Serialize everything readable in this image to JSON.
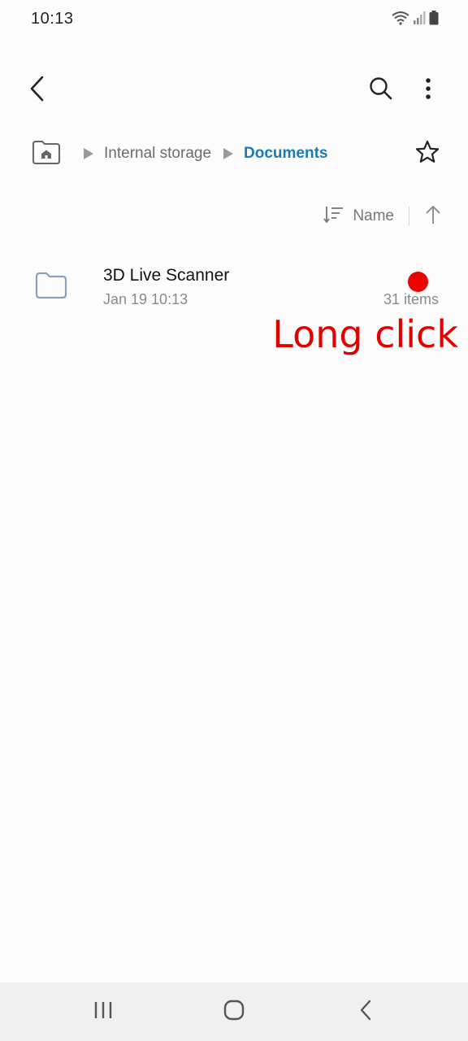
{
  "status_bar": {
    "time": "10:13",
    "icons": [
      "wifi-icon",
      "signal-icon",
      "battery-icon"
    ]
  },
  "app_bar": {
    "back_icon": "chevron-left-icon",
    "search_icon": "search-icon",
    "more_icon": "more-vertical-icon"
  },
  "breadcrumb": {
    "home_icon": "home-folder-icon",
    "items": [
      {
        "label": "Internal storage"
      },
      {
        "label": "Documents"
      }
    ],
    "favorite_icon": "star-outline-icon"
  },
  "sort": {
    "label": "Name",
    "direction_icon": "arrow-up-icon"
  },
  "files": [
    {
      "name": "3D Live Scanner",
      "date": "Jan 19 10:13",
      "count": "31 items",
      "icon": "folder-icon"
    }
  ],
  "annotation": {
    "gesture": "Long click",
    "color": "#e00000"
  },
  "nav_bar": {
    "recents_icon": "recents-icon",
    "home_icon": "home-icon",
    "back_icon": "back-icon"
  },
  "colors": {
    "accent": "#1a7bb3",
    "background": "#fcfcfc",
    "nav_background": "#f0f0f0"
  }
}
